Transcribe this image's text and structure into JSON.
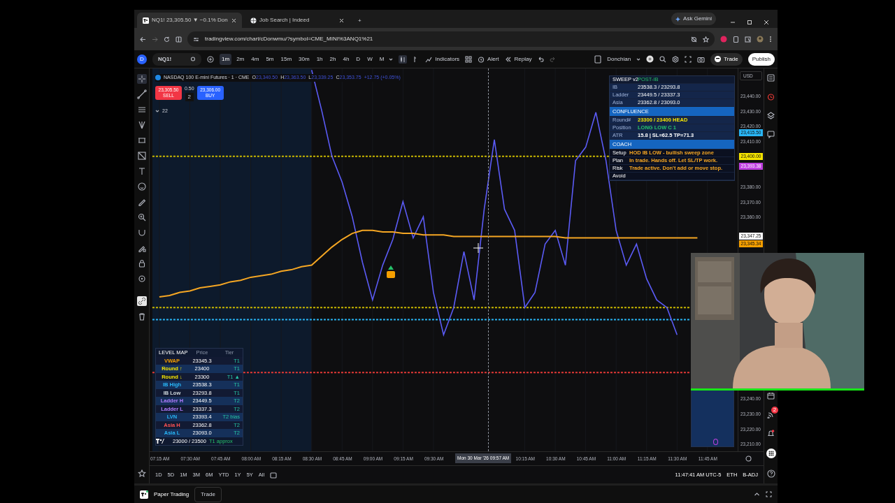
{
  "browser": {
    "tabs": [
      {
        "title": "NQ1! 23,305.50 ▼ −0.1% Don",
        "selected": true,
        "kind": "chart"
      },
      {
        "title": "Job Search | Indeed",
        "selected": false,
        "kind": "search"
      }
    ],
    "new_tab": "+",
    "ask_button": "Ask Gemini",
    "url": "tradingview.com/chart/cDonwmu/?symbol=CME_MINI%3ANQ1%21"
  },
  "toolbar": {
    "avatar": "D",
    "symbol": "NQ1!",
    "intervals": [
      {
        "label": "1m",
        "selected": true
      },
      {
        "label": "2m",
        "selected": false
      },
      {
        "label": "4m",
        "selected": false
      },
      {
        "label": "5m",
        "selected": false
      },
      {
        "label": "15m",
        "selected": false
      },
      {
        "label": "30m",
        "selected": false
      },
      {
        "label": "1h",
        "selected": false
      },
      {
        "label": "2h",
        "selected": false
      },
      {
        "label": "4h",
        "selected": false
      },
      {
        "label": "D",
        "selected": false
      },
      {
        "label": "W",
        "selected": false
      },
      {
        "label": "M",
        "selected": false
      }
    ],
    "indicators": "Indicators",
    "alert": "Alert",
    "replay": "Replay",
    "layout_name": "Donchian",
    "trade": "Trade",
    "publish": "Publish"
  },
  "legend": {
    "title": "NASDAQ 100 E-mini Futures · 1 · CME",
    "ohlc": [
      {
        "label": "O",
        "value": "23,340.50"
      },
      {
        "label": "H",
        "value": "23,363.50"
      },
      {
        "label": "L",
        "value": "23,339.25"
      },
      {
        "label": "C",
        "value": "23,353.75"
      }
    ],
    "change": "+12.75 (+0.05%)"
  },
  "order": {
    "sell_price": "23,305.50",
    "sell": "SELL",
    "spread": "0.50",
    "quantity": "2",
    "buy_price": "23,306.00",
    "buy": "BUY"
  },
  "indicator_count": "22",
  "chart": {
    "chart_data": {
      "type": "line",
      "x": [
        7.25,
        7.3333,
        7.4167,
        7.5,
        7.5833,
        7.6667,
        7.75,
        7.8333,
        7.9167,
        8,
        8.0833,
        8.1667,
        8.25,
        8.3333,
        8.4167,
        8.5,
        8.5833,
        8.6667,
        8.75,
        8.8333,
        8.9167,
        9,
        9.0833,
        9.1667,
        9.25,
        9.3333,
        9.4167,
        9.5,
        9.5833,
        9.6667,
        9.75,
        9.8333,
        9.9167,
        10,
        10.0833,
        10.1667,
        10.25,
        10.3333,
        10.4167,
        10.5,
        10.5833,
        10.6667,
        10.75,
        10.8333,
        10.9167,
        11,
        11.0833,
        11.1667,
        11.25,
        11.3333,
        11.4167,
        11.5,
        11.5833,
        11.6667
      ],
      "ylim": [
        23205,
        23458
      ],
      "xlim": [
        7.17,
        12.21
      ],
      "grid": true,
      "yticks": [
        {
          "value": 23440,
          "label": "23,440.00"
        },
        {
          "value": 23430,
          "label": "23,430.00"
        },
        {
          "value": 23420,
          "label": "23,420.00"
        },
        {
          "value": 23410,
          "label": "23,410.00"
        },
        {
          "value": 23380,
          "label": "23,380.00"
        },
        {
          "value": 23370,
          "label": "23,370.00"
        },
        {
          "value": 23360,
          "label": "23,360.00"
        },
        {
          "value": 23240,
          "label": "23,240.00"
        },
        {
          "value": 23230,
          "label": "23,230.00"
        },
        {
          "value": 23220,
          "label": "23,220.00"
        },
        {
          "value": 23210,
          "label": "23,210.00"
        }
      ],
      "xticks": [
        {
          "value": 7.25,
          "label": "07:15 AM"
        },
        {
          "value": 7.5,
          "label": "07:30 AM"
        },
        {
          "value": 7.75,
          "label": "07:45 AM"
        },
        {
          "value": 8,
          "label": "08:00 AM"
        },
        {
          "value": 8.25,
          "label": "08:15 AM"
        },
        {
          "value": 8.5,
          "label": "08:30 AM"
        },
        {
          "value": 8.75,
          "label": "08:45 AM"
        },
        {
          "value": 9,
          "label": "09:00 AM"
        },
        {
          "value": 9.25,
          "label": "09:15 AM"
        },
        {
          "value": 9.5,
          "label": "09:30 AM"
        },
        {
          "value": 10.25,
          "label": "10:15 AM"
        },
        {
          "value": 10.5,
          "label": "10:30 AM"
        },
        {
          "value": 10.75,
          "label": "10:45 AM"
        },
        {
          "value": 11,
          "label": "11:00 AM"
        },
        {
          "value": 11.25,
          "label": "11:15 AM"
        },
        {
          "value": 11.5,
          "label": "11:30 AM"
        },
        {
          "value": 11.75,
          "label": "11:45 AM"
        }
      ],
      "series": [
        {
          "color": "#5b5bf5",
          "values": [
            null,
            null,
            null,
            null,
            null,
            null,
            null,
            null,
            null,
            null,
            null,
            null,
            null,
            null,
            null,
            23457,
            23430,
            23400,
            23383,
            23360,
            23330,
            23305,
            23328,
            23345,
            23370,
            23346,
            23360,
            23310,
            23282,
            23300,
            23337,
            23305,
            23365,
            23411,
            23365,
            23351,
            23300,
            23310,
            23342,
            23351,
            23328,
            23397,
            23406,
            23429,
            23397,
            23351,
            23328,
            23342,
            23319,
            23305,
            23300,
            23282,
            null,
            null
          ]
        },
        {
          "color": "#f5a623",
          "values": [
            23307,
            23308,
            23310,
            23311,
            23313,
            23314,
            23315,
            23317,
            23318,
            23320,
            23321,
            23322,
            23324,
            23325,
            23327,
            23328,
            23334,
            23340,
            23345,
            23349,
            23351,
            23351,
            23350,
            23350,
            23349,
            23349,
            23348,
            23348,
            23348,
            23347,
            23347,
            23347,
            23347,
            23347,
            23347,
            23347,
            23347,
            23347,
            23347,
            23347,
            23346,
            23346,
            23346,
            23346,
            23346,
            23346,
            23346,
            23346,
            23346,
            23346,
            23346,
            23346,
            23346,
            23346
          ]
        }
      ],
      "ref_lines": [
        {
          "axis": "y",
          "value": 23400,
          "color": "#c9b800"
        },
        {
          "axis": "y",
          "value": 23300,
          "color": "#c9b800"
        },
        {
          "axis": "y",
          "value": 23292,
          "color": "#29b6f6"
        },
        {
          "axis": "y",
          "value": 23257,
          "color": "#e53935"
        }
      ]
    }
  },
  "price_axis": {
    "currency": "USD",
    "tags": [
      {
        "label": "23,415.50",
        "color": "#29b6f6"
      },
      {
        "label": "23,400.00",
        "color": "#f5e400"
      },
      {
        "label": "23,393.38",
        "color": "#c040e0"
      },
      {
        "label": "23,347.25",
        "color": "#ffffff"
      },
      {
        "label": "23,345.34",
        "color": "#f59f00"
      }
    ]
  },
  "crosshair_label": "Mon 30 Mar '26  09:57 AM",
  "sweep_panel": {
    "title": "SWEEP v2",
    "phase": "POST-IB",
    "levels": [
      {
        "label": "IB",
        "value": "23538.3 / 23293.8"
      },
      {
        "label": "Ladder",
        "value": "23449.5 / 23337.3"
      },
      {
        "label": "Asia",
        "value": "23362.8 / 23093.0"
      }
    ],
    "confluence_title": "CONFLUENCE",
    "confluence": [
      {
        "label": "Round#",
        "value": "23300 / 23400 HEAD",
        "color": "#f5e400"
      },
      {
        "label": "Position",
        "value": "LONG LOW C 1",
        "color": "#26c26b"
      },
      {
        "label": "ATR",
        "value": "15.8 | SL=62.5 TP=71.3",
        "color": "#ffffff"
      }
    ],
    "coach_title": "COACH",
    "coach": [
      {
        "label": "Setup",
        "value": "HOD IB LOW - bullish sweep zone",
        "color": "#f5a623"
      },
      {
        "label": "Plan",
        "value": "In trade. Hands off. Let SL/TP work.",
        "color": "#f5a623"
      },
      {
        "label": "Risk",
        "value": "Trade active. Don't add or move stop.",
        "color": "#f5a623"
      },
      {
        "label": "Avoid"
      }
    ]
  },
  "level_map": {
    "columns": [
      "LEVEL MAP",
      "Price",
      "Tier"
    ],
    "rows": [
      {
        "label": "VWAP",
        "price": "23345.3",
        "tier": "T1",
        "color": "#f59f00"
      },
      {
        "label": "Round ↑",
        "price": "23400",
        "tier": "T1",
        "color": "#f5e400"
      },
      {
        "label": "Round ↓",
        "price": "23300",
        "tier": "T1 ▲",
        "color": "#f5e400"
      },
      {
        "label": "IB High",
        "price": "23538.3",
        "tier": "T1",
        "color": "#29b6f6"
      },
      {
        "label": "IB Low",
        "price": "23293.8",
        "tier": "T1",
        "color": "#cfd8dc"
      },
      {
        "label": "Ladder H",
        "price": "23449.5",
        "tier": "T2",
        "color": "#b07cff"
      },
      {
        "label": "Ladder L",
        "price": "23337.3",
        "tier": "T2",
        "color": "#b07cff"
      },
      {
        "label": "LVN",
        "price": "23393.4",
        "tier": "T2 bias",
        "color": "#29b6f6"
      },
      {
        "label": "Asia H",
        "price": "23362.8",
        "tier": "T2",
        "color": "#ff5252"
      },
      {
        "label": "Asia L",
        "price": "23093.0",
        "tier": "T2",
        "color": "#29b6f6"
      }
    ],
    "footer_price": "23000 / 23500",
    "footer_tier": "T1 approx"
  },
  "range_buttons": [
    "1D",
    "5D",
    "1M",
    "3M",
    "6M",
    "YTD",
    "1Y",
    "5Y",
    "All"
  ],
  "status": {
    "time": "11:47:41 AM UTC-5",
    "session": "ETH",
    "adjust": "B-ADJ"
  },
  "bottom": {
    "paper_trading": "Paper Trading",
    "trade": "Trade"
  },
  "sidebar": {
    "feed_badge": "2"
  },
  "webcam": {
    "kind": "picture"
  }
}
